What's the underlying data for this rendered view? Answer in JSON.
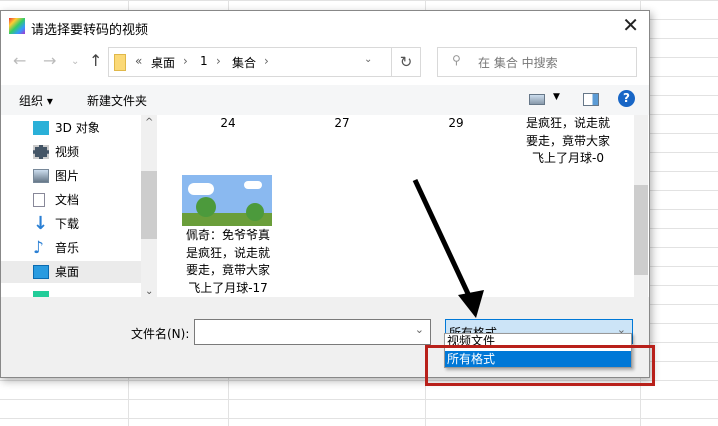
{
  "dialog": {
    "title": "请选择要转码的视频"
  },
  "nav": {
    "breadcrumb": [
      "«",
      "桌面",
      "1",
      "集合"
    ],
    "search_placeholder": "在 集合 中搜索"
  },
  "toolbar": {
    "organize": "组织 ▾",
    "new_folder": "新建文件夹"
  },
  "sidebar": {
    "items": [
      {
        "label": "3D 对象"
      },
      {
        "label": "视频"
      },
      {
        "label": "图片"
      },
      {
        "label": "文档"
      },
      {
        "label": "下载"
      },
      {
        "label": "音乐"
      },
      {
        "label": "桌面"
      }
    ]
  },
  "files": {
    "row1": [
      "24",
      "27",
      "29"
    ],
    "row1_last": [
      "是疯狂，说走就",
      "要走，竟带大家",
      "飞上了月球-0"
    ],
    "item2": [
      "佩奇：免爷爷真",
      "是疯狂，说走就",
      "要走，竟带大家",
      "飞上了月球-17"
    ]
  },
  "bottom": {
    "filename_label": "文件名(N):",
    "filename_value": "",
    "filter_selected": "所有格式",
    "filter_options": [
      "视频文件",
      "所有格式"
    ]
  },
  "colors": {
    "highlight": "#0078d7",
    "annotation": "#b8201a"
  }
}
